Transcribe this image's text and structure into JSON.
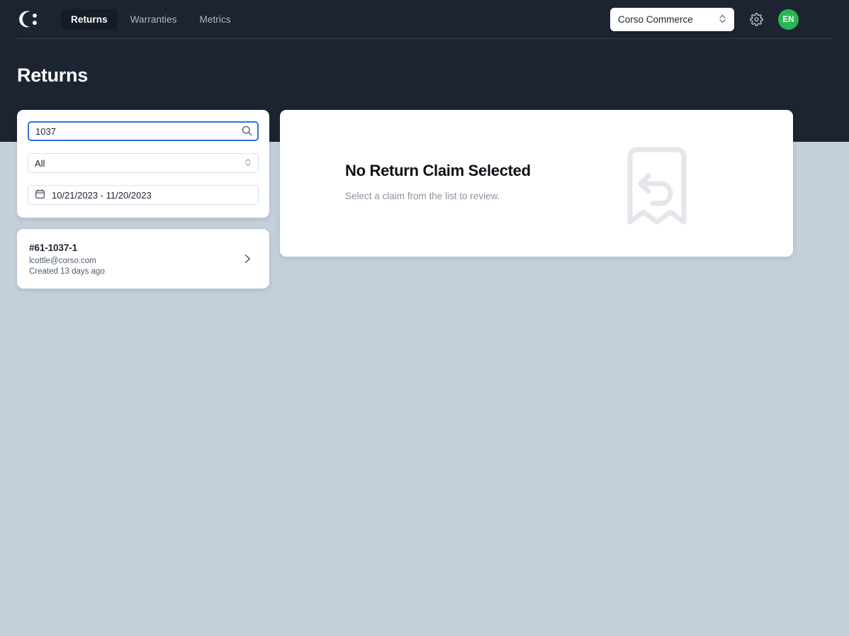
{
  "app": {
    "logo_icon": "corso-c-colon-logo",
    "brand_color": "#1d2431",
    "accent_green": "#2bb656",
    "focus_blue": "#2f6fe0"
  },
  "header": {
    "nav": [
      {
        "label": "Returns",
        "active": true
      },
      {
        "label": "Warranties",
        "active": false
      },
      {
        "label": "Metrics",
        "active": false
      }
    ],
    "store_selector": {
      "value": "Corso Commerce",
      "icon": "chevron-updown-icon"
    },
    "settings_icon": "gear-icon",
    "avatar": {
      "initials": "EN"
    }
  },
  "page": {
    "title": "Returns"
  },
  "filters": {
    "search": {
      "value": "1037",
      "placeholder": "Search",
      "icon": "search-icon"
    },
    "status_select": {
      "value": "All",
      "icon": "chevron-updown-icon"
    },
    "date_range": {
      "value": "10/21/2023 - 11/20/2023",
      "icon": "calendar-icon"
    }
  },
  "claims": [
    {
      "id": "#61-1037-1",
      "email": "lcottle@corso.com",
      "created": "Created 13 days ago",
      "chevron": "chevron-right-icon"
    }
  ],
  "main": {
    "empty_title": "No Return Claim Selected",
    "empty_subtitle": "Select a claim from the list to review.",
    "empty_icon": "return-bookmark-icon"
  }
}
